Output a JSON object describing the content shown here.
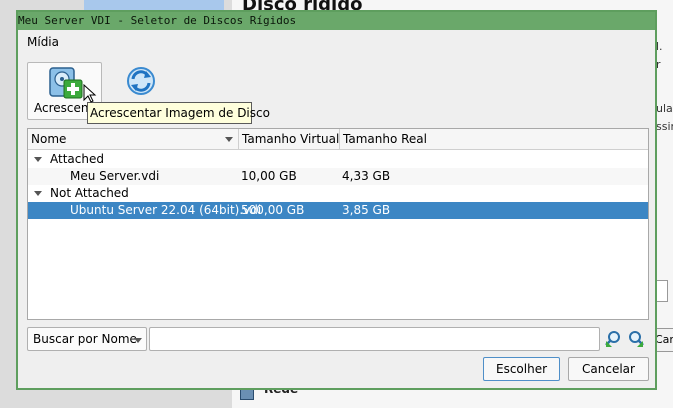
{
  "background": {
    "title": "Disco rígido",
    "right_fragments": [
      "l.",
      "r",
      "ula",
      "ssin"
    ],
    "partial_button": "Cancela",
    "bottom_item": "Rede"
  },
  "dialog": {
    "title": "Meu Server VDI - Seletor de Discos Rígidos",
    "menu": [
      "Mídia"
    ],
    "toolbar": {
      "add_label": "Acrescentar",
      "add_icon": "hard-disk-add-icon",
      "refresh_icon": "refresh-icon"
    },
    "tooltip": "Acrescentar Imagem de Disco",
    "table": {
      "columns": [
        "Nome",
        "Tamanho Virtual",
        "Tamanho Real"
      ],
      "groups": [
        {
          "label": "Attached",
          "rows": [
            {
              "name": "Meu Server.vdi",
              "virtual": "10,00 GB",
              "actual": "4,33 GB",
              "selected": false
            }
          ]
        },
        {
          "label": "Not Attached",
          "rows": [
            {
              "name": "Ubuntu Server 22.04 (64bit).vdi",
              "virtual": "500,00 GB",
              "actual": "3,85 GB",
              "selected": true
            }
          ]
        }
      ]
    },
    "search": {
      "mode": "Buscar por Nome",
      "value": "",
      "prev_icon": "find-previous-icon",
      "next_icon": "find-next-icon"
    },
    "buttons": {
      "choose": "Escolher",
      "cancel": "Cancelar"
    }
  },
  "colors": {
    "titlebar": "#6aa86a",
    "selection": "#3c86c4",
    "tooltip_bg": "#ffffdc"
  }
}
